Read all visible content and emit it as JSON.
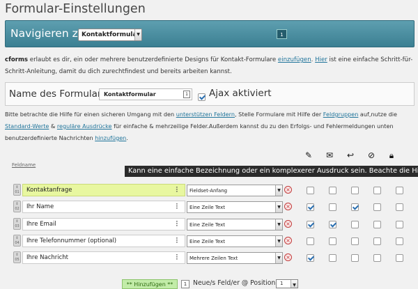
{
  "page_title": "Formular-Einstellungen",
  "nav": {
    "label": "Navigieren zu",
    "selected": "Kontaktformular",
    "badge": "1"
  },
  "intro": {
    "brand": "cforms",
    "text1": " erlaubt es dir, ein oder mehrere benutzerdefinierte Designs für Kontakt-Formulare ",
    "link1": "einzufügen",
    "text2": ". ",
    "link2": "Hier",
    "text3": " ist eine einfache Schritt-für-Schritt-Anleitung, damit du dich zurechtfindest und bereits arbeiten kannst."
  },
  "form_name": {
    "label": "Name des Formulars",
    "value": "Kontaktformular",
    "input_badge": "1",
    "ajax_label": "Ajax aktiviert",
    "ajax_checked": true
  },
  "help": {
    "t1": "Bitte betrachte die Hilfe für einen sicheren Umgang mit den ",
    "l1": "unterstützen Feldern",
    "t2": ", Stelle Formulare mit Hilfe der ",
    "l2": "Feldgruppen",
    "t3": " auf,nutze die ",
    "l3": "Standard-Werte",
    "t4": " & ",
    "l4": "reguläre Ausdrücke",
    "t5": " für einfache & mehrzeilige Felder.Außerdem kannst du zu den Erfolgs- und Fehlermeldungen unten benutzerdefinierte Nachrichten ",
    "l5": "hinzufügen",
    "t6": "."
  },
  "columns": {
    "feldname": "Feldname",
    "icons": [
      "edit-icon",
      "envelope-icon",
      "reply-icon",
      "block-icon",
      "lock-icon"
    ]
  },
  "tooltip": "Kann eine einfache Bezeichnung oder ein komplexerer Ausdruck sein. Beachte die Hilfe!",
  "fields": [
    {
      "num": "01",
      "label": "Kontaktanfrage",
      "type": "Fieldset-Anfang",
      "checks": [
        false,
        false,
        false,
        false,
        false
      ]
    },
    {
      "num": "02",
      "label": "Ihr Name",
      "type": "Eine Zeile Text",
      "checks": [
        true,
        false,
        true,
        false,
        false
      ]
    },
    {
      "num": "03",
      "label": "Ihre Email",
      "type": "Eine Zeile Text",
      "checks": [
        true,
        true,
        false,
        false,
        false
      ]
    },
    {
      "num": "04",
      "label": "Ihre Telefonnummer (optional)",
      "type": "Eine Zeile Text",
      "checks": [
        false,
        false,
        false,
        false,
        false
      ]
    },
    {
      "num": "05",
      "label": "Ihre Nachricht",
      "type": "Mehrere Zeilen Text",
      "checks": [
        true,
        false,
        false,
        false,
        false
      ]
    }
  ],
  "add": {
    "button": "** Hinzufügen **",
    "count": "1",
    "text": "Neue/s Feld/er @ Position",
    "position": "1"
  }
}
